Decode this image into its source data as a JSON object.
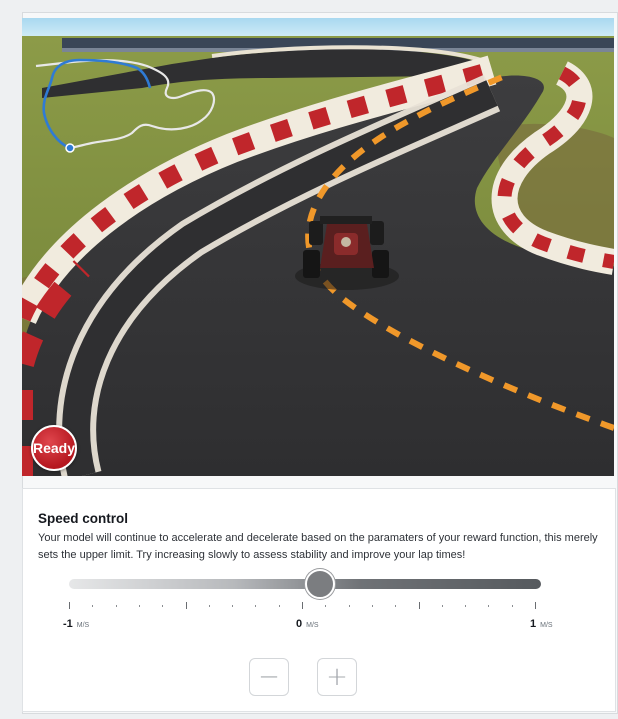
{
  "video": {
    "status_badge": "Ready"
  },
  "speed_control": {
    "title": "Speed control",
    "description": "Your model will continue to accelerate and decelerate based on the paramaters of your reward function, this merely sets the upper limit. Try increasing slowly to assess stability and improve your lap times!",
    "slider": {
      "min": -1,
      "max": 1,
      "value": 0,
      "unit": "M/S",
      "labels": {
        "min": "-1",
        "mid": "0",
        "max": "1"
      }
    },
    "decrease_label": "−",
    "increase_label": "+"
  },
  "colors": {
    "ready_badge": "#c41e26",
    "track_line": "#f0982a",
    "minimap_path": "#2f7bd4"
  }
}
